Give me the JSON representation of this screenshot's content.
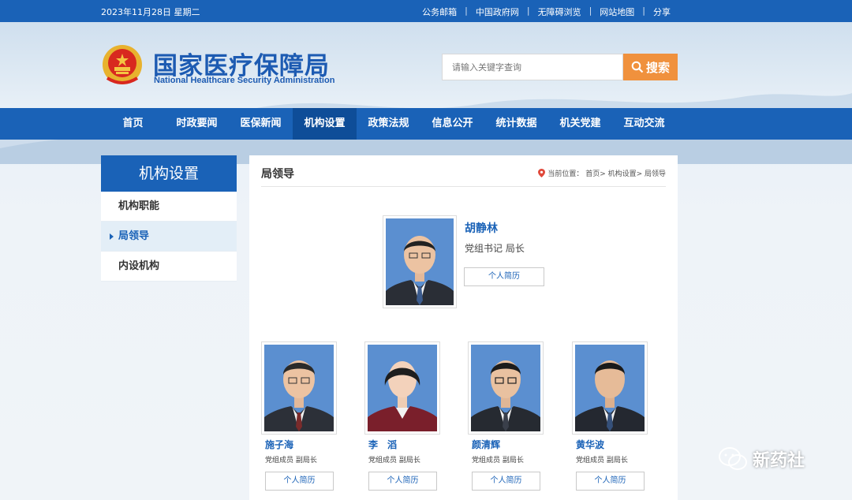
{
  "topbar": {
    "date": "2023年11月28日 星期二",
    "links": [
      "公务邮箱",
      "中国政府网",
      "无障碍浏览",
      "网站地图",
      "分享"
    ]
  },
  "header": {
    "title_cn": "国家医疗保障局",
    "title_en": "National Healthcare Security Administration"
  },
  "search": {
    "placeholder": "请输入关键字查询",
    "button_label": "搜索"
  },
  "nav": {
    "items": [
      "首页",
      "时政要闻",
      "医保新闻",
      "机构设置",
      "政策法规",
      "信息公开",
      "统计数据",
      "机关党建",
      "互动交流"
    ],
    "active": "机构设置"
  },
  "sidebar": {
    "heading": "机构设置",
    "items": [
      "机构职能",
      "局领导",
      "内设机构"
    ],
    "active": "局领导"
  },
  "main": {
    "title": "局领导",
    "breadcrumb": "当前位置： 首页> 机构设置> 局领导",
    "cv_label": "个人简历",
    "leader": {
      "name": "胡静林",
      "title": "党组书记 局长"
    },
    "deputies": [
      {
        "name": "施子海",
        "title": "党组成员 副局长"
      },
      {
        "name": "李　滔",
        "title": "党组成员 副局长"
      },
      {
        "name": "颜清辉",
        "title": "党组成员 副局长"
      },
      {
        "name": "黄华波",
        "title": "党组成员 副局长"
      }
    ]
  },
  "watermark": {
    "text": "新药社"
  },
  "colors": {
    "brand_blue": "#1a62b7",
    "nav_active": "#0e4d98",
    "search_orange": "#f0913d"
  }
}
